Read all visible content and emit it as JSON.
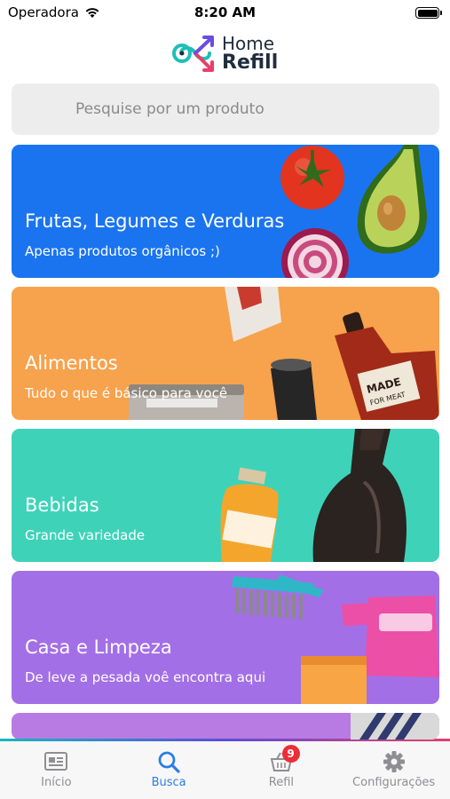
{
  "status_bar": {
    "carrier": "Operadora",
    "time": "8:20 AM"
  },
  "brand": {
    "line1": "Home",
    "line2": "Refill"
  },
  "search": {
    "placeholder": "Pesquise por um produto"
  },
  "categories": [
    {
      "title": "Frutas, Legumes e Verduras",
      "subtitle": "Apenas produtos orgânicos ;)",
      "color": "#1a74f0",
      "icons": [
        "tomato",
        "avocado",
        "onion"
      ]
    },
    {
      "title": "Alimentos",
      "subtitle": "Tudo o que é básico para você",
      "color": "#f7a24c",
      "icons": [
        "sauce-bottle",
        "coffee-bag",
        "canister"
      ]
    },
    {
      "title": "Bebidas",
      "subtitle": "Grande variedade",
      "color": "#3ed3b9",
      "icons": [
        "juice-bottle",
        "wine-bottle"
      ]
    },
    {
      "title": "Casa e Limpeza",
      "subtitle": "De leve a pesada voê encontra aqui",
      "color": "#a36fe6",
      "icons": [
        "scrub-brush",
        "sponge",
        "detergent-bottle"
      ]
    }
  ],
  "tab_bar": {
    "tabs": [
      {
        "label": "Início",
        "icon": "home-card-icon",
        "active": false
      },
      {
        "label": "Busca",
        "icon": "search-icon",
        "active": true
      },
      {
        "label": "Refil",
        "icon": "basket-icon",
        "active": false,
        "badge": "9"
      },
      {
        "label": "Configurações",
        "icon": "gear-icon",
        "active": false
      }
    ],
    "active_color": "#2a7ee6",
    "inactive_color": "#8e8e93"
  }
}
